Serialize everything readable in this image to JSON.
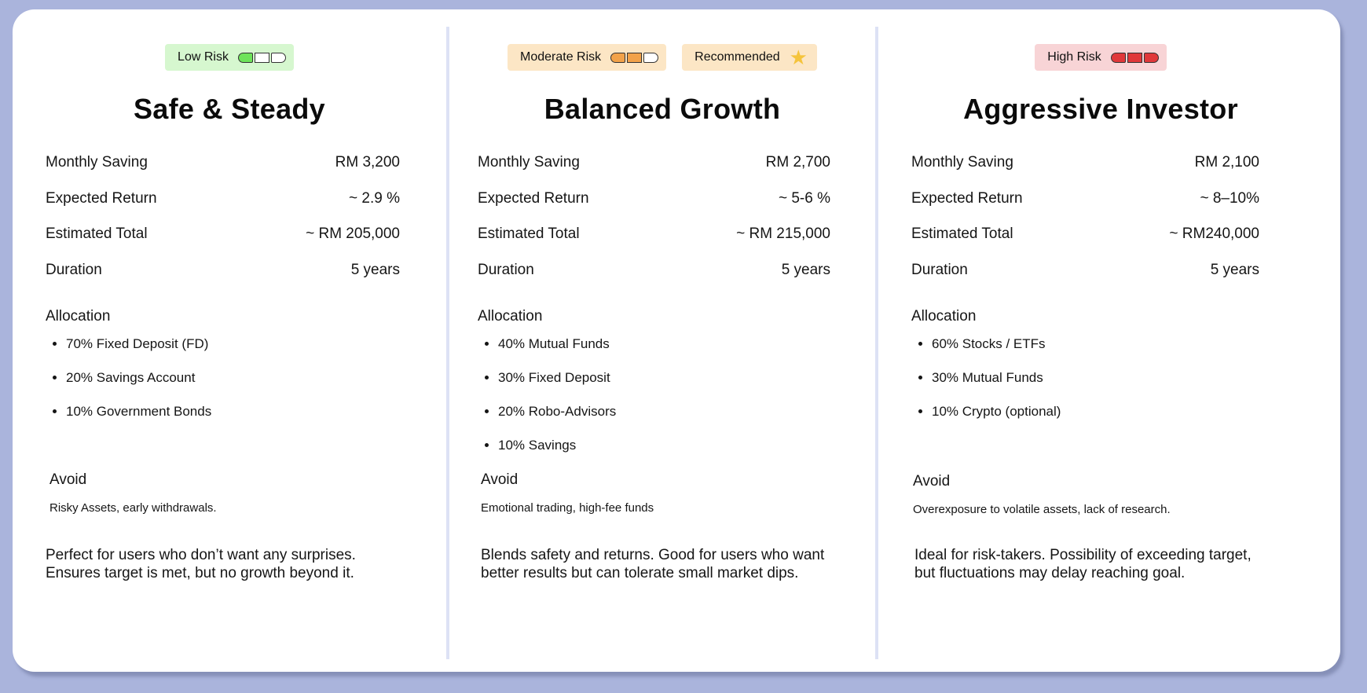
{
  "colors": {
    "page_background": "#aab4dc",
    "low_risk_fill": "#6ee35a",
    "moderate_risk_fill": "#f2a24a",
    "high_risk_fill": "#e0383a",
    "star": "#f5c43c"
  },
  "plans": [
    {
      "badges": [
        {
          "label": "Low Risk",
          "meter": {
            "level": 1,
            "of": 3
          }
        }
      ],
      "title": "Safe & Steady",
      "stats": [
        {
          "label": "Monthly Saving",
          "value": "RM 3,200"
        },
        {
          "label": "Expected Return",
          "value": "~ 2.9 %"
        },
        {
          "label": "Estimated Total",
          "value": "~ RM 205,000"
        },
        {
          "label": "Duration",
          "value": "5 years"
        }
      ],
      "allocation_label": "Allocation",
      "allocation": [
        "70% Fixed Deposit (FD)",
        "20% Savings Account",
        "10% Government Bonds"
      ],
      "avoid_label": "Avoid",
      "avoid_text": "Risky Assets, early withdrawals.",
      "description": "Perfect for users who don’t want any surprises.\nEnsures target is met, but no growth beyond it."
    },
    {
      "badges": [
        {
          "label": "Moderate Risk",
          "meter": {
            "level": 2,
            "of": 3
          }
        },
        {
          "label": "Recommended",
          "icon": "star-icon"
        }
      ],
      "title": "Balanced Growth",
      "stats": [
        {
          "label": "Monthly Saving",
          "value": "RM 2,700"
        },
        {
          "label": "Expected Return",
          "value": "~ 5-6 %"
        },
        {
          "label": "Estimated Total",
          "value": "~ RM 215,000"
        },
        {
          "label": "Duration",
          "value": "5 years"
        }
      ],
      "allocation_label": "Allocation",
      "allocation": [
        "40% Mutual Funds",
        "30% Fixed Deposit",
        "20% Robo-Advisors",
        "10% Savings"
      ],
      "avoid_label": "Avoid",
      "avoid_text": "Emotional trading, high-fee funds",
      "description": "Blends safety and returns. Good for users who want\nbetter results but can tolerate small market dips."
    },
    {
      "badges": [
        {
          "label": "High Risk",
          "meter": {
            "level": 3,
            "of": 3
          }
        }
      ],
      "title": "Aggressive Investor",
      "stats": [
        {
          "label": "Monthly Saving",
          "value": "RM 2,100"
        },
        {
          "label": "Expected Return",
          "value": "~ 8–10%"
        },
        {
          "label": "Estimated Total",
          "value": "~ RM240,000"
        },
        {
          "label": "Duration",
          "value": "5 years"
        }
      ],
      "allocation_label": "Allocation",
      "allocation": [
        "60% Stocks / ETFs",
        "30% Mutual Funds",
        "10% Crypto (optional)"
      ],
      "avoid_label": "Avoid",
      "avoid_text": "Overexposure to volatile assets, lack of research.",
      "description": "Ideal for risk-takers. Possibility of exceeding target,\nbut fluctuations may delay reaching goal."
    }
  ]
}
